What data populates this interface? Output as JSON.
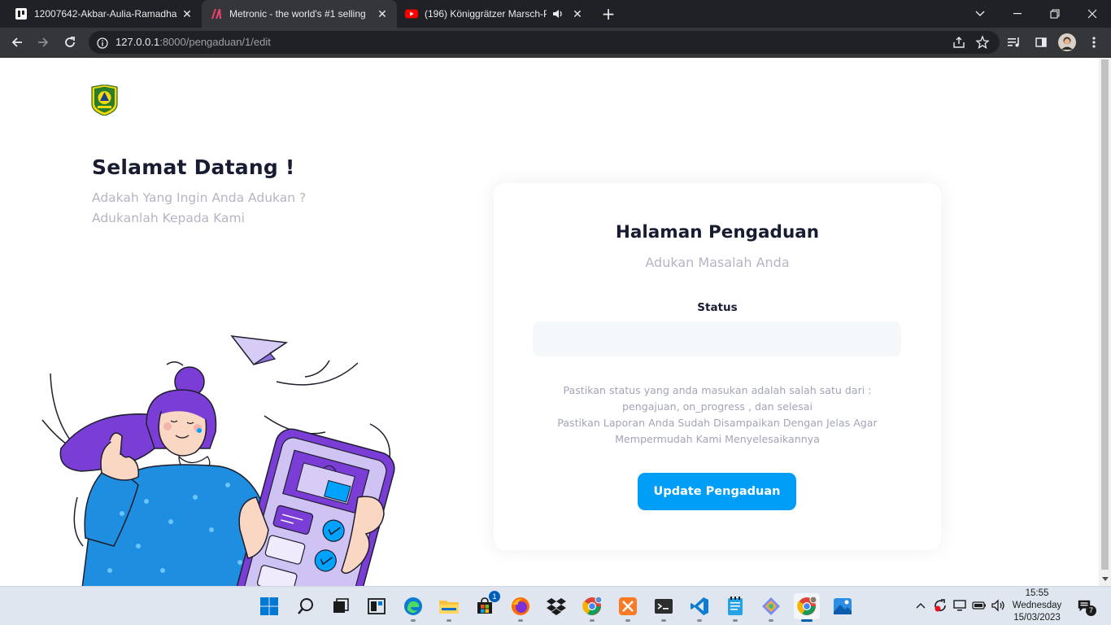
{
  "browser": {
    "tabs": [
      {
        "title": "12007642-Akbar-Aulia-Ramadhan"
      },
      {
        "title": "Metronic - the world's #1 selling"
      },
      {
        "title": "(196) Königgrätzer Marsch-P"
      }
    ],
    "url_host": "127.0.0.1",
    "url_path": ":8000/pengaduan/1/edit"
  },
  "page": {
    "welcome_title": "Selamat Datang !",
    "welcome_sub1": "Adakah Yang Ingin Anda Adukan ?",
    "welcome_sub2": "Adukanlah Kepada Kami"
  },
  "form": {
    "title": "Halaman Pengaduan",
    "subtitle": "Adukan Masalah Anda",
    "status_label": "Status",
    "status_value": "",
    "note_line1": "Pastikan status yang anda masukan adalah salah satu dari :",
    "note_line2": "pengajuan, on_progress , dan selesai",
    "note_line3": "Pastikan Laporan Anda Sudah Disampaikan Dengan Jelas Agar",
    "note_line4": "Mempermudah Kami Menyelesaikannya",
    "submit_label": "Update Pengaduan"
  },
  "taskbar": {
    "store_badge": "1",
    "time": "15:55",
    "day": "Wednesday",
    "date": "15/03/2023",
    "notification_count": "7"
  },
  "colors": {
    "primary": "#009ef7",
    "heading": "#181c32",
    "muted": "#b5b5c3",
    "input_bg": "#f5f8fa"
  }
}
